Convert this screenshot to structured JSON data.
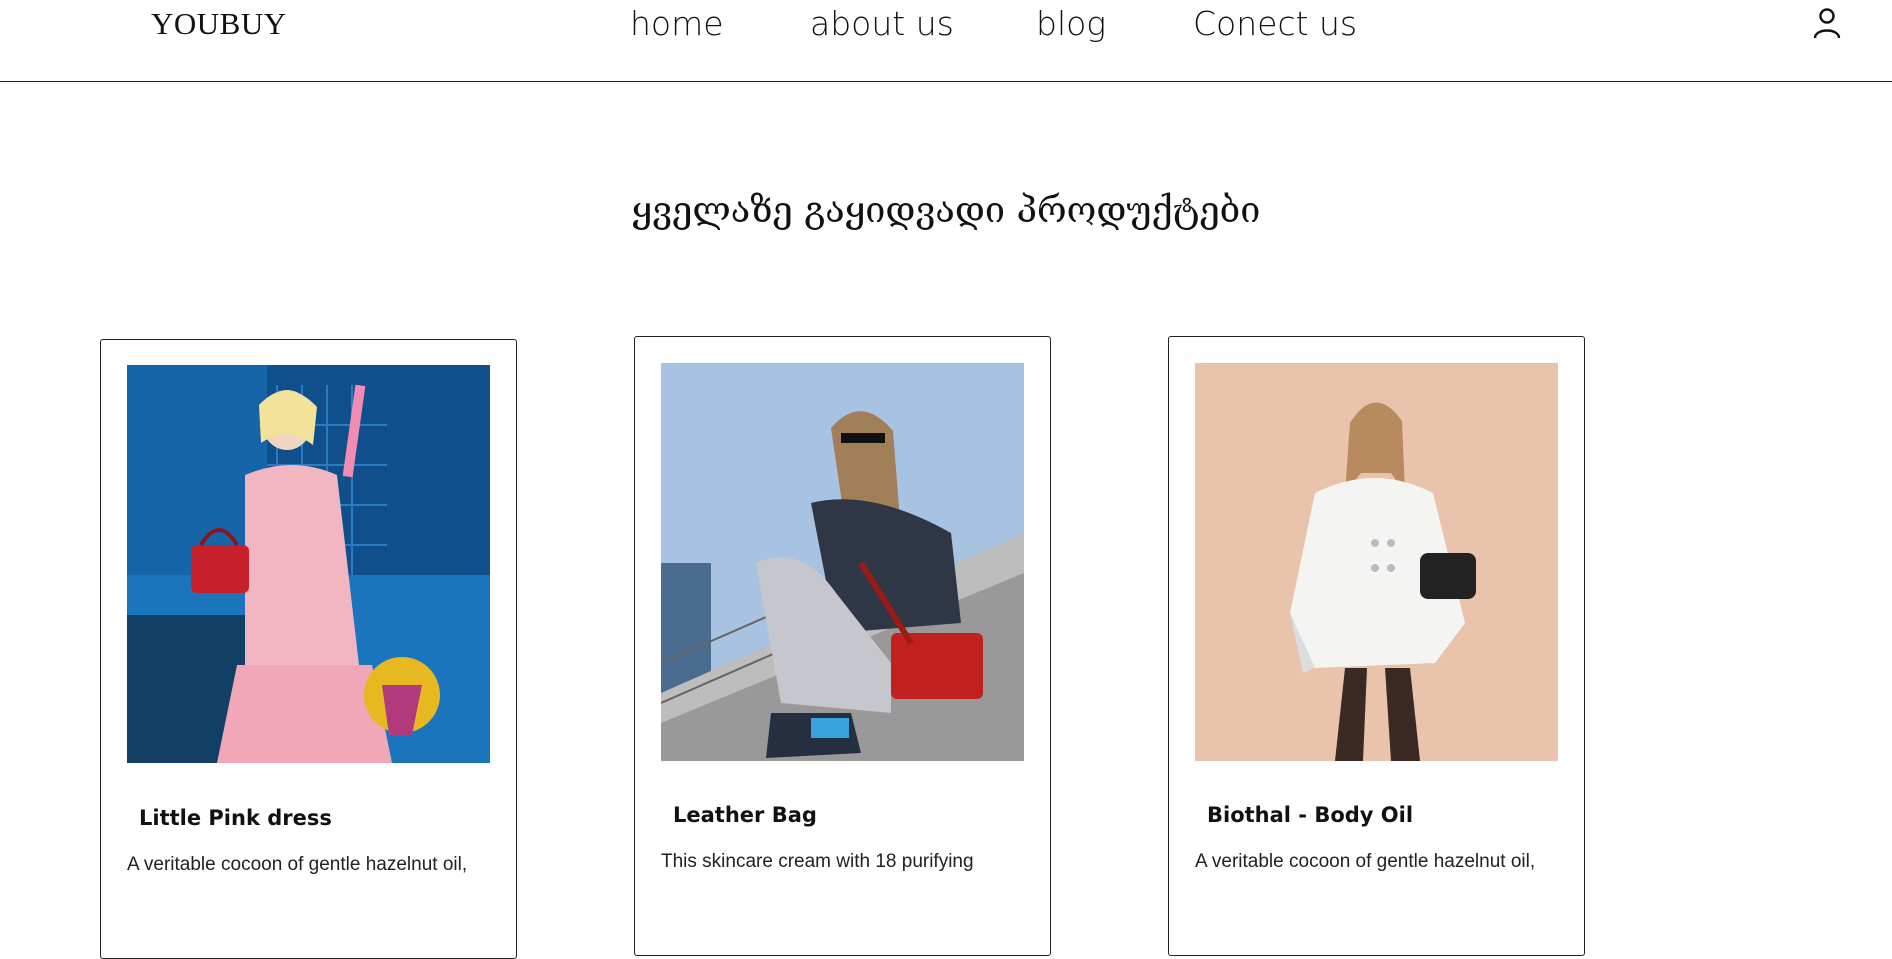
{
  "header": {
    "logo": "YOUBUY",
    "nav": [
      {
        "label": "home"
      },
      {
        "label": "about us"
      },
      {
        "label": "blog"
      },
      {
        "label": "Conect us"
      }
    ],
    "user_icon": "user-icon"
  },
  "main": {
    "title": "ყველაზე გაყიდვადი პროდუქტები",
    "products": [
      {
        "name": "Little Pink dress",
        "desc": "A veritable cocoon of gentle hazelnut oil,",
        "bg": "#1f6fb4"
      },
      {
        "name": "Leather Bag",
        "desc": "This skincare cream with 18 purifying",
        "bg": "#b9cde4"
      },
      {
        "name": "Biothal - Body Oil",
        "desc": "A veritable cocoon of gentle hazelnut oil,",
        "bg": "#e9c4ae"
      }
    ]
  }
}
